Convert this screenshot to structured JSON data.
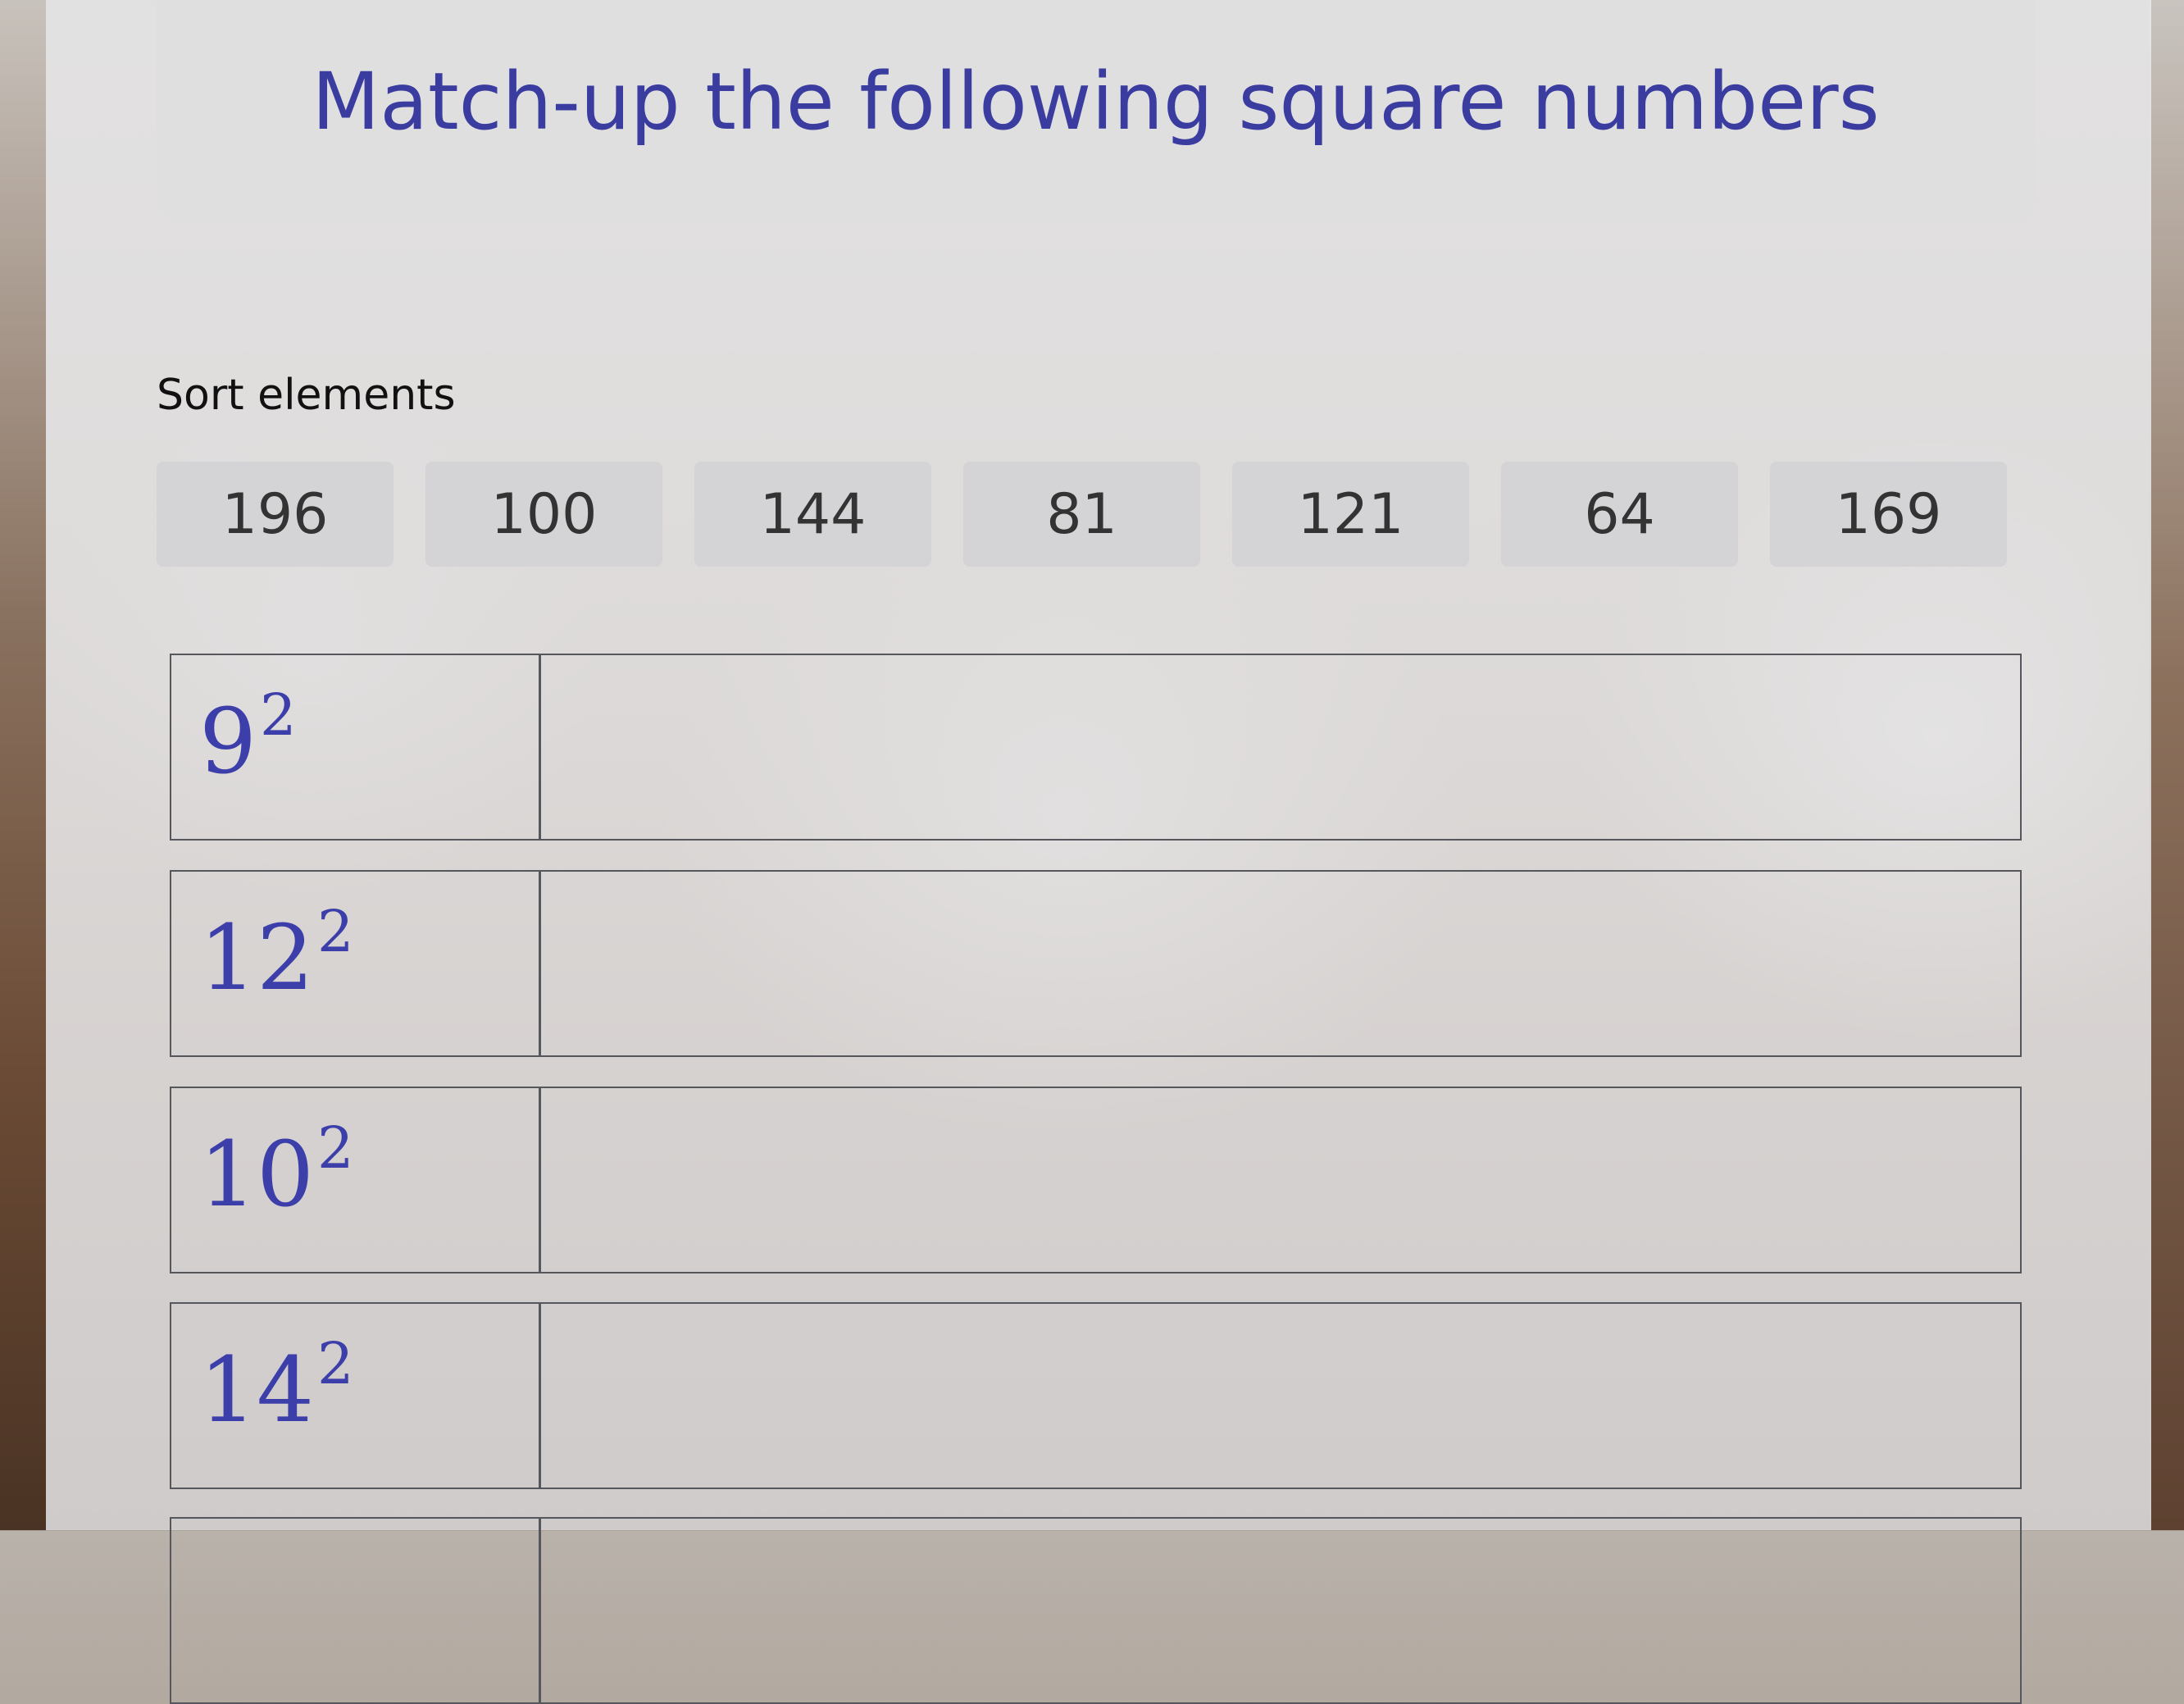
{
  "title": "Match-up the following square numbers",
  "sort_label": "Sort elements",
  "chips": [
    "196",
    "100",
    "144",
    "81",
    "121",
    "64",
    "169"
  ],
  "rows": [
    {
      "base": "9",
      "exponent": "2"
    },
    {
      "base": "12",
      "exponent": "2"
    },
    {
      "base": "10",
      "exponent": "2"
    },
    {
      "base": "14",
      "exponent": "2"
    },
    {
      "base": "",
      "exponent": ""
    }
  ],
  "colors": {
    "title": "#3a3ca0",
    "prompt": "#3c3eaa",
    "chip_bg": "#d4d4d6",
    "border": "#55575d"
  }
}
